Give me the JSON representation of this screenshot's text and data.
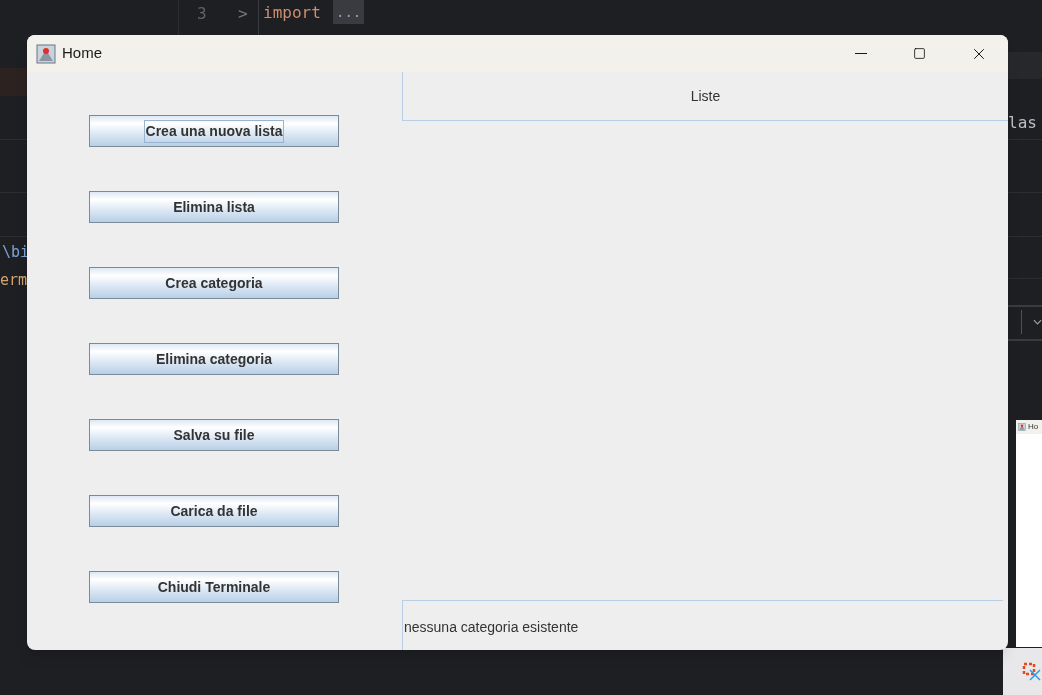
{
  "ide": {
    "line_number": "3",
    "fold_marker": ">",
    "code_keyword": "import",
    "folded_text": "...",
    "class_fragment": "las",
    "path_fragment": "\\bi",
    "terminal_fragment": "erm"
  },
  "window": {
    "title": "Home",
    "buttons": [
      {
        "label": "Crea una nuova lista",
        "focused": true
      },
      {
        "label": "Elimina lista",
        "focused": false
      },
      {
        "label": "Crea categoria",
        "focused": false
      },
      {
        "label": "Elimina categoria",
        "focused": false
      },
      {
        "label": "Salva su file",
        "focused": false
      },
      {
        "label": "Carica da file",
        "focused": false
      },
      {
        "label": "Chiudi Terminale",
        "focused": false
      }
    ],
    "list_header": "Liste",
    "status": "nessuna categoria esistente"
  },
  "thumbnail": {
    "title": "Ho"
  }
}
